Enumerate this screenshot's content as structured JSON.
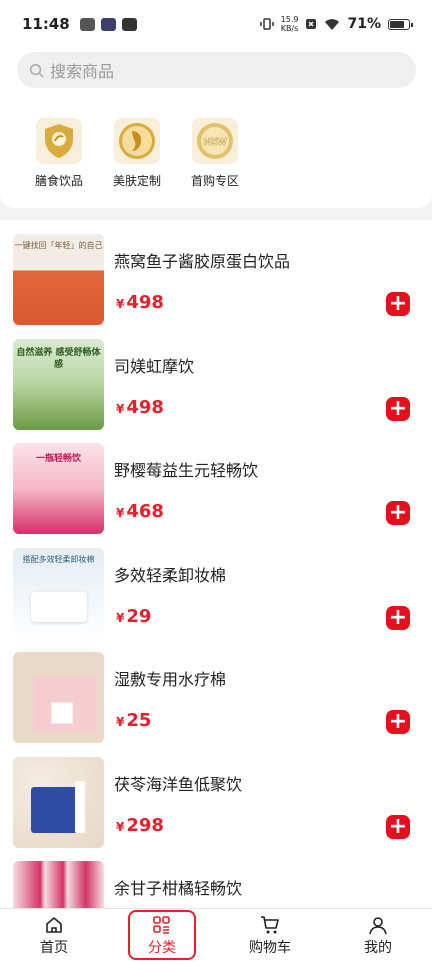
{
  "status": {
    "time": "11:48",
    "net_speed_top": "15.9",
    "net_speed_bottom": "KB/s",
    "battery": "71%"
  },
  "search": {
    "placeholder": "搜索商品"
  },
  "categories": [
    {
      "label": "膳食饮品",
      "icon": "dietary-shield-icon"
    },
    {
      "label": "美肤定制",
      "icon": "beauty-face-icon"
    },
    {
      "label": "首购专区",
      "icon": "new-badge-icon"
    }
  ],
  "products": [
    {
      "name": "燕窝鱼子酱胶原蛋白饮品",
      "currency": "¥",
      "price": "498",
      "thumb_colors": [
        "#f1ede6",
        "#e0673a"
      ],
      "thumb_text": "一键找回「年轻」的自己"
    },
    {
      "name": "司媄虹摩饮",
      "currency": "¥",
      "price": "498",
      "thumb_colors": [
        "#d9ead3",
        "#6b9b43"
      ],
      "thumb_text": "自然滋养 感受舒畅体感"
    },
    {
      "name": "野樱莓益生元轻畅饮",
      "currency": "¥",
      "price": "468",
      "thumb_colors": [
        "#fbe3ea",
        "#d6306a"
      ],
      "thumb_text": "一瓶轻畅饮"
    },
    {
      "name": "多效轻柔卸妆棉",
      "currency": "¥",
      "price": "29",
      "thumb_colors": [
        "#e4edf2",
        "#ffffff"
      ],
      "thumb_text": "搭配多效轻柔卸妆棉"
    },
    {
      "name": "湿敷专用水疗棉",
      "currency": "¥",
      "price": "25",
      "thumb_colors": [
        "#ead9c6",
        "#f5cdd0"
      ],
      "thumb_text": ""
    },
    {
      "name": "茯苓海洋鱼低聚饮",
      "currency": "¥",
      "price": "298",
      "thumb_colors": [
        "#efe7dc",
        "#2e4ea6"
      ],
      "thumb_text": ""
    },
    {
      "name": "余甘子柑橘轻畅饮",
      "currency": "¥",
      "price": "",
      "thumb_colors": [
        "#f6dde2",
        "#d23565"
      ],
      "thumb_text": ""
    }
  ],
  "nav": [
    {
      "label": "首页",
      "icon": "home-icon"
    },
    {
      "label": "分类",
      "icon": "category-icon",
      "active": true
    },
    {
      "label": "购物车",
      "icon": "cart-icon"
    },
    {
      "label": "我的",
      "icon": "profile-icon"
    }
  ],
  "colors": {
    "accent": "#e1212b",
    "add_button": "#e60f1e"
  }
}
